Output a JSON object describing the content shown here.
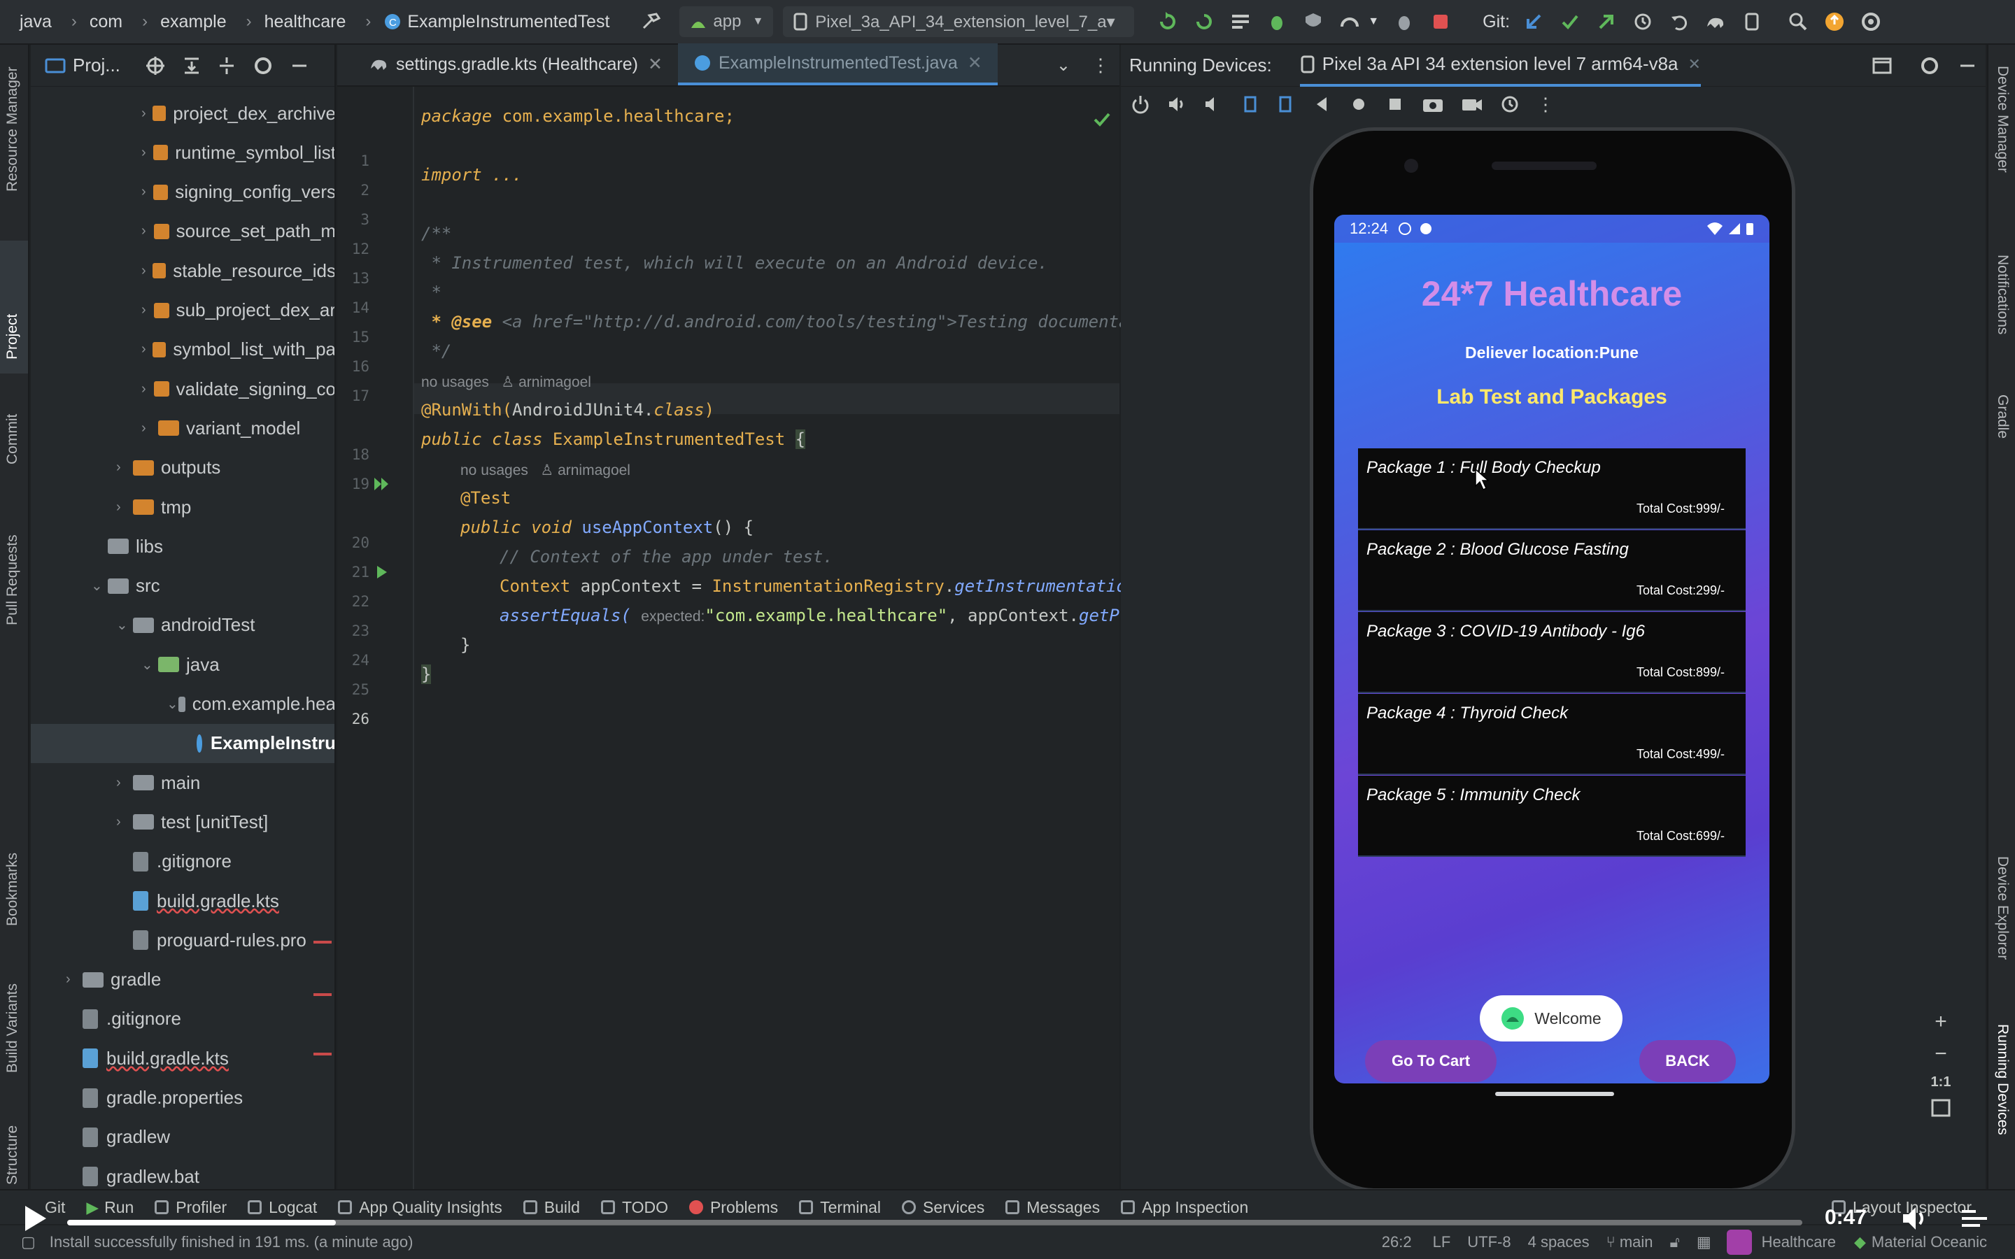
{
  "topbar": {
    "breadcrumb": [
      "java",
      "com",
      "example",
      "healthcare"
    ],
    "file": "ExampleInstrumentedTest",
    "run_config": "app",
    "device": "Pixel_3a_API_34_extension_level_7_a▾",
    "git_label": "Git:"
  },
  "left_stripe": [
    "Resource Manager",
    "Project",
    "Commit",
    "Pull Requests",
    "Bookmarks",
    "Build Variants",
    "Structure"
  ],
  "right_stripe": [
    "Device Manager",
    "Notifications",
    "Gradle",
    "Device Explorer",
    "Running Devices"
  ],
  "project": {
    "title": "Proj...",
    "items": [
      {
        "label": "project_dex_archive",
        "indent": 3,
        "type": "folder",
        "arrow": "›"
      },
      {
        "label": "runtime_symbol_list",
        "indent": 3,
        "type": "folder",
        "arrow": "›"
      },
      {
        "label": "signing_config_vers",
        "indent": 3,
        "type": "folder",
        "arrow": "›"
      },
      {
        "label": "source_set_path_m",
        "indent": 3,
        "type": "folder",
        "arrow": "›"
      },
      {
        "label": "stable_resource_ids",
        "indent": 3,
        "type": "folder",
        "arrow": "›"
      },
      {
        "label": "sub_project_dex_ar",
        "indent": 3,
        "type": "folder",
        "arrow": "›"
      },
      {
        "label": "symbol_list_with_pa",
        "indent": 3,
        "type": "folder",
        "arrow": "›"
      },
      {
        "label": "validate_signing_co",
        "indent": 3,
        "type": "folder",
        "arrow": "›"
      },
      {
        "label": "variant_model",
        "indent": 3,
        "type": "folder",
        "arrow": "›"
      },
      {
        "label": "outputs",
        "indent": 2,
        "type": "folder",
        "arrow": "›"
      },
      {
        "label": "tmp",
        "indent": 2,
        "type": "folder",
        "arrow": "›"
      },
      {
        "label": "libs",
        "indent": 1,
        "type": "grey",
        "arrow": ""
      },
      {
        "label": "src",
        "indent": 1,
        "type": "grey",
        "arrow": "⌄"
      },
      {
        "label": "androidTest",
        "indent": 2,
        "type": "grey",
        "arrow": "⌄"
      },
      {
        "label": "java",
        "indent": 3,
        "type": "green",
        "arrow": "⌄"
      },
      {
        "label": "com.example.hea",
        "indent": 4,
        "type": "grey",
        "arrow": "⌄"
      },
      {
        "label": "ExampleInstru",
        "indent": 5,
        "type": "class",
        "arrow": ""
      },
      {
        "label": "main",
        "indent": 2,
        "type": "grey",
        "arrow": "›"
      },
      {
        "label": "test [unitTest]",
        "indent": 2,
        "type": "grey",
        "arrow": "›"
      },
      {
        "label": ".gitignore",
        "indent": 2,
        "type": "file",
        "arrow": ""
      },
      {
        "label": "build.gradle.kts",
        "indent": 2,
        "type": "gradle",
        "arrow": ""
      },
      {
        "label": "proguard-rules.pro",
        "indent": 2,
        "type": "file",
        "arrow": ""
      },
      {
        "label": "gradle",
        "indent": 0,
        "type": "grey",
        "arrow": "›"
      },
      {
        "label": ".gitignore",
        "indent": 0,
        "type": "file",
        "arrow": ""
      },
      {
        "label": "build.gradle.kts",
        "indent": 0,
        "type": "gradle",
        "arrow": ""
      },
      {
        "label": "gradle.properties",
        "indent": 0,
        "type": "file",
        "arrow": ""
      },
      {
        "label": "gradlew",
        "indent": 0,
        "type": "file",
        "arrow": ""
      },
      {
        "label": "gradlew.bat",
        "indent": 0,
        "type": "file",
        "arrow": ""
      }
    ]
  },
  "editor": {
    "tabs": [
      {
        "label": "settings.gradle.kts (Healthcare)",
        "active": false
      },
      {
        "label": "ExampleInstrumentedTest.java",
        "active": true
      }
    ],
    "line_numbers": [
      "1",
      "2",
      "3",
      "12",
      "13",
      "14",
      "15",
      "16",
      "17",
      "18",
      "19",
      "20",
      "21",
      "22",
      "23",
      "24",
      "25",
      "26"
    ],
    "code": {
      "l1": "package com.example.healthcare;",
      "l3": "import ...",
      "l13": "/**",
      "l14": " * Instrumented test, which will execute on an Android device.",
      "l15": " *",
      "l16_tag": " * @see",
      "l16_rest": " <a href=\"http://d.android.com/tools/testing\">Testing documentat",
      "l17": " */",
      "hint1": "no usages   ♙ arnimagoel",
      "l18": "@RunWith(AndroidJUnit4.class)",
      "l19": "public class ExampleInstrumentedTest {",
      "hint2": "no usages   ♙ arnimagoel",
      "l20": "@Test",
      "l21": "public void useAppContext() {",
      "l22": "// Context of the app under test.",
      "l23": "Context appContext = InstrumentationRegistry.getInstrumentation",
      "l24a": "assertEquals(",
      "l24hint": "expected:",
      "l24b": " \"com.example.healthcare\", appContext.getP",
      "l25": "}",
      "l26": "}"
    }
  },
  "devices": {
    "title": "Running Devices:",
    "device_tab": "Pixel 3a API 34 extension level 7 arm64-v8a"
  },
  "phone": {
    "time": "12:24",
    "app_title": "24*7 Healthcare",
    "location": "Deliever location:Pune",
    "subtitle": "Lab Test and Packages",
    "packages": [
      {
        "name": "Package 1 : Full Body Checkup",
        "cost": "Total Cost:999/-"
      },
      {
        "name": "Package 2 : Blood Glucose Fasting",
        "cost": "Total Cost:299/-"
      },
      {
        "name": "Package 3 : COVID-19 Antibody - Ig6",
        "cost": "Total Cost:899/-"
      },
      {
        "name": "Package 4 : Thyroid Check",
        "cost": "Total Cost:499/-"
      },
      {
        "name": "Package 5 : Immunity Check",
        "cost": "Total Cost:699/-"
      }
    ],
    "toast": "Welcome",
    "cart_button": "Go To Cart",
    "back_button": "BACK"
  },
  "bottom_tools": [
    "Git",
    "Run",
    "Profiler",
    "Logcat",
    "App Quality Insights",
    "Build",
    "TODO",
    "Problems",
    "Terminal",
    "Services",
    "Messages",
    "App Inspection",
    "Layout Inspector"
  ],
  "status": {
    "message": "Install successfully finished in 191 ms. (a minute ago)",
    "position": "26:2",
    "line_sep": "LF",
    "encoding": "UTF-8",
    "indent": "4 spaces",
    "branch": "main",
    "project": "Healthcare",
    "theme": "Material Oceanic"
  },
  "player": {
    "time": "0:47",
    "progress": 0.155
  },
  "zoom_controls": [
    "+",
    "−",
    "1:1"
  ]
}
